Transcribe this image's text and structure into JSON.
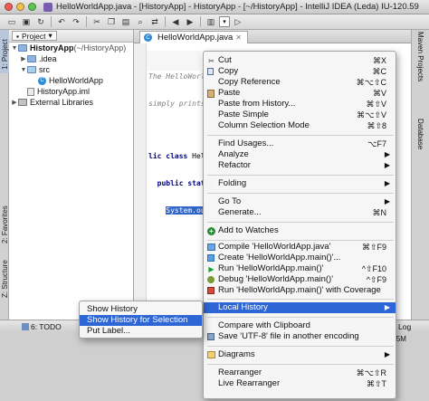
{
  "window": {
    "title": "HelloWorldApp.java - [HistoryApp] - HistoryApp - [~/HistoryApp] - IntelliJ IDEA (Leda) IU-120.59"
  },
  "left_tabs": {
    "project": "1: Project",
    "favorites": "2: Favorites",
    "structure": "Z: Structure"
  },
  "right_tabs": {
    "maven": "Maven Projects",
    "database": "Database"
  },
  "project_panel": {
    "selector": "Project",
    "tree": [
      {
        "label": "HistoryApp",
        "suffix": " (~/HistoryApp)"
      },
      {
        "label": ".idea"
      },
      {
        "label": "src"
      },
      {
        "label": "HelloWorldApp"
      },
      {
        "label": "HistoryApp.iml"
      },
      {
        "label": "External Libraries"
      }
    ]
  },
  "editor": {
    "tab": "HelloWorldApp.java",
    "lines": {
      "comment1": "The HelloWorld",
      "comment2": "simply prints",
      "class_kw": "lic class ",
      "class_name": "Hell",
      "method_kw": "public static",
      "selected": "System.ou"
    }
  },
  "context_menu": {
    "items": [
      {
        "label": "Cut",
        "shortcut": "⌘X",
        "icon": "scissors-icon"
      },
      {
        "label": "Copy",
        "shortcut": "⌘C",
        "icon": "copy-icon"
      },
      {
        "label": "Copy Reference",
        "shortcut": "⌘⌥⇧C"
      },
      {
        "label": "Paste",
        "shortcut": "⌘V",
        "icon": "paste-icon"
      },
      {
        "label": "Paste from History...",
        "shortcut": "⌘⇧V"
      },
      {
        "label": "Paste Simple",
        "shortcut": "⌘⌥⇧V"
      },
      {
        "label": "Column Selection Mode",
        "shortcut": "⌘⇧8"
      },
      {
        "label": "Find Usages...",
        "shortcut": "⌥F7"
      },
      {
        "label": "Analyze"
      },
      {
        "label": "Refactor"
      },
      {
        "label": "Folding"
      },
      {
        "label": "Go To"
      },
      {
        "label": "Generate...",
        "shortcut": "⌘N"
      },
      {
        "label": "Add to Watches",
        "icon": "watch-icon"
      },
      {
        "label": "Compile 'HelloWorldApp.java'",
        "shortcut": "⌘⇧F9",
        "icon": "compile-icon"
      },
      {
        "label": "Create 'HelloWorldApp.main()'...",
        "icon": "create-config-icon"
      },
      {
        "label": "Run 'HelloWorldApp.main()'",
        "shortcut": "^⇧F10",
        "icon": "run-icon"
      },
      {
        "label": "Debug 'HelloWorldApp.main()'",
        "shortcut": "^⇧F9",
        "icon": "debug-icon"
      },
      {
        "label": "Run 'HelloWorldApp.main()' with Coverage",
        "icon": "coverage-icon"
      },
      {
        "label": "Local History"
      },
      {
        "label": "Compare with Clipboard"
      },
      {
        "label": "Save 'UTF-8' file in another encoding",
        "icon": "save-icon"
      },
      {
        "label": "Diagrams",
        "icon": "diagram-icon"
      },
      {
        "label": "Rearranger",
        "shortcut": "⌘⌥⇧R"
      },
      {
        "label": "Live Rearranger",
        "shortcut": "⌘⇧T"
      }
    ]
  },
  "submenu": {
    "items": [
      {
        "label": "Show History"
      },
      {
        "label": "Show History for Selection"
      },
      {
        "label": "Put Label..."
      }
    ]
  },
  "bottom_bar": {
    "todo": "6: TODO",
    "log": "Log"
  },
  "status_bar": {
    "memory": "of 795M"
  },
  "colors": {
    "selection": "#2f66d6",
    "editor_selection": "#2f66c7"
  }
}
